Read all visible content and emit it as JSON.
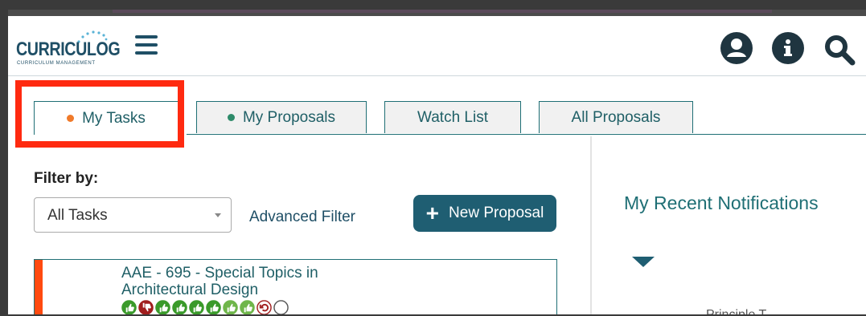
{
  "header": {
    "logo_text": "CURRICULOG",
    "logo_sub": "CURRICULUM MANAGEMENT",
    "icons": [
      "menu-icon",
      "user-icon",
      "info-icon",
      "search-icon"
    ]
  },
  "tabs": [
    {
      "label": "My Tasks",
      "dot_color": "#f07a2a",
      "active": true
    },
    {
      "label": "My Proposals",
      "dot_color": "#2e8b6a",
      "active": false
    },
    {
      "label": "Watch List",
      "active": false
    },
    {
      "label": "All Proposals",
      "active": false
    }
  ],
  "filter": {
    "label": "Filter by:",
    "selected": "All Tasks",
    "advanced_label": "Advanced Filter"
  },
  "new_proposal_label": "New Proposal",
  "task_card": {
    "title": "AAE - 695 - Special Topics in Architectural Design",
    "votes": [
      "approve",
      "reject",
      "approve",
      "approve",
      "approve",
      "approve",
      "approve-outline",
      "approve-outline",
      "return",
      "pending"
    ]
  },
  "notifications": {
    "title": "My Recent Notifications",
    "snippet": "Principle T..."
  },
  "colors": {
    "accent": "#1f5e72",
    "highlight": "#ff2a10",
    "approve": "#3a9a2a",
    "reject": "#a01e1e"
  }
}
